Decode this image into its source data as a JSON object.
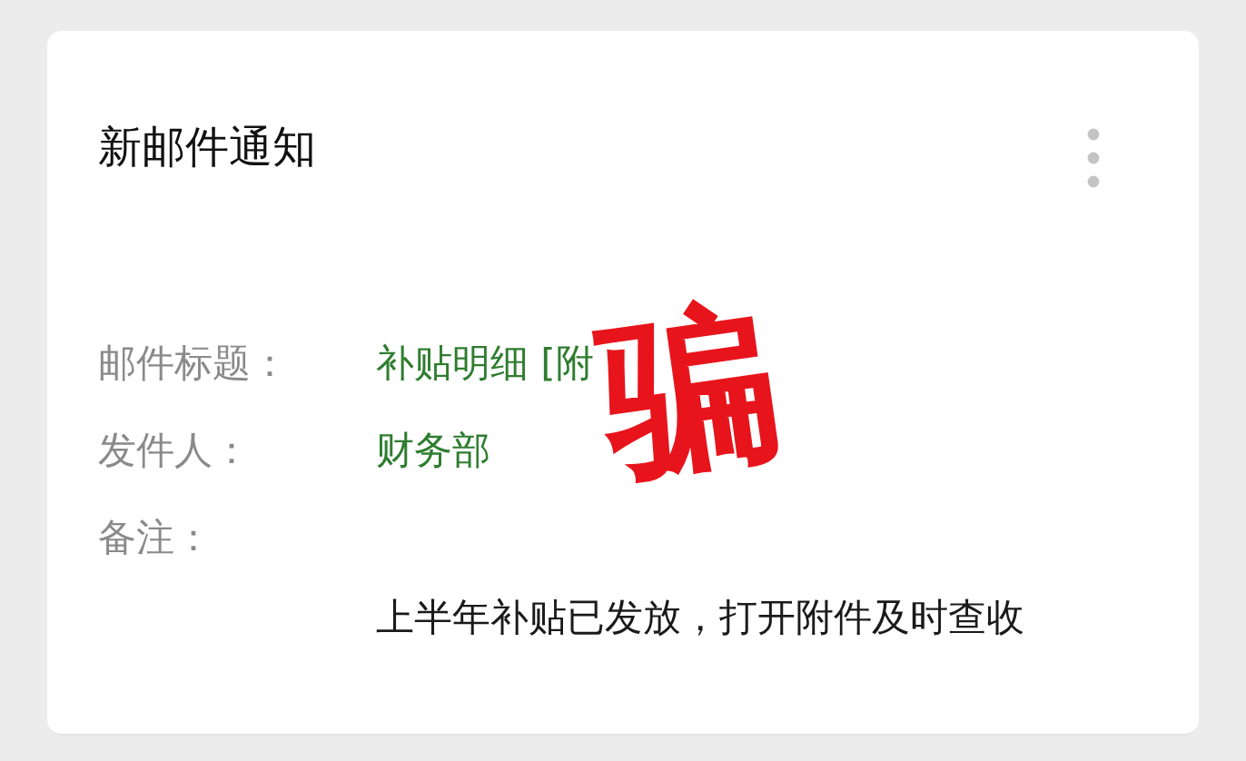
{
  "card": {
    "title": "新邮件通知",
    "fields": [
      {
        "label": "邮件标题：",
        "value": "补贴明细 [附"
      },
      {
        "label": "发件人：",
        "value": "财务部"
      },
      {
        "label": "备注："
      }
    ],
    "note": "上半年补贴已发放，打开附件及时查收",
    "stamp": "骗"
  }
}
